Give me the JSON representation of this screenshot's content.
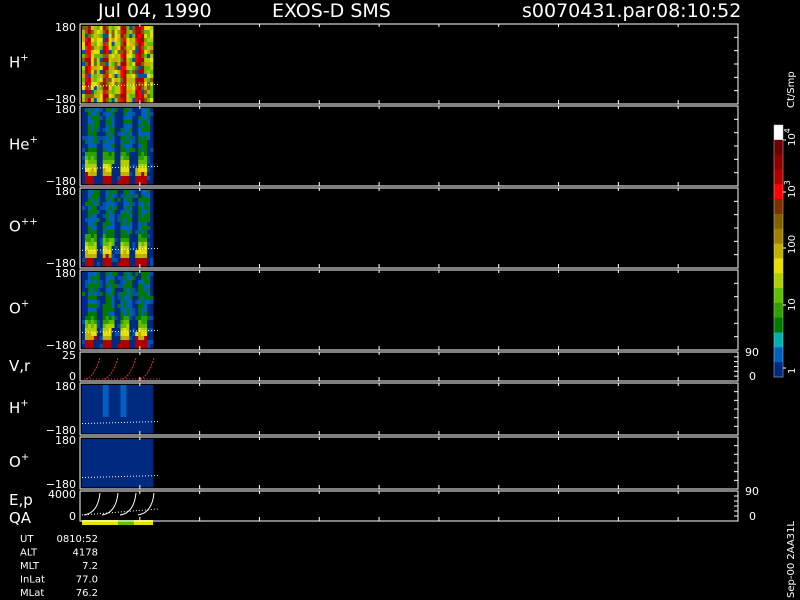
{
  "header": {
    "date": "Jul 04, 1990",
    "instrument": "EXOS-D SMS",
    "filename": "s0070431.par",
    "time": "08:10:52"
  },
  "chart_data": {
    "type": "heatmap",
    "panels": [
      {
        "id": "h",
        "label": "H",
        "sup": "+",
        "y_top": "180",
        "y_bottom": "−180",
        "ylim": [
          -180,
          180
        ]
      },
      {
        "id": "he",
        "label": "He",
        "sup": "+",
        "y_top": "180",
        "y_bottom": "−180",
        "ylim": [
          -180,
          180
        ]
      },
      {
        "id": "opp",
        "label": "O",
        "sup": "++",
        "y_top": "180",
        "y_bottom": "−180",
        "ylim": [
          -180,
          180
        ]
      },
      {
        "id": "o",
        "label": "O",
        "sup": "+",
        "y_top": "180",
        "y_bottom": "−180",
        "ylim": [
          -180,
          180
        ]
      },
      {
        "id": "vr",
        "label": "V,r",
        "sup": "",
        "y_top": "25",
        "y_bottom": "0",
        "right_top": "90",
        "right_bottom": "0",
        "ylim": [
          0,
          25
        ]
      },
      {
        "id": "h2",
        "label": "H",
        "sup": "+",
        "y_top": "180",
        "y_bottom": "−180",
        "ylim": [
          -180,
          180
        ]
      },
      {
        "id": "o2",
        "label": "O",
        "sup": "+",
        "y_top": "180",
        "y_bottom": "−180",
        "ylim": [
          -180,
          180
        ]
      },
      {
        "id": "ep",
        "label": "E,p",
        "label2": "QA",
        "sup": "",
        "y_top": "4000",
        "y_bottom": "0",
        "right_top": "90",
        "right_bottom": "0",
        "ylim": [
          0,
          4000
        ]
      }
    ],
    "colorbar": {
      "unit": "Ct/Smp",
      "ticks": [
        {
          "base": "10",
          "exp": "4"
        },
        {
          "base": "10",
          "exp": "3"
        },
        {
          "base": "100",
          "exp": ""
        },
        {
          "base": "10",
          "exp": ""
        },
        {
          "base": "1",
          "exp": ""
        }
      ],
      "colors": [
        "#ffffff",
        "#6a0000",
        "#8c0000",
        "#b00000",
        "#ff0000",
        "#7a3000",
        "#806000",
        "#a08000",
        "#c0b000",
        "#e8e000",
        "#b0d000",
        "#60c000",
        "#30a000",
        "#007a00",
        "#00b0b0",
        "#0060c0",
        "#002a80"
      ]
    },
    "info_labels": [
      "UT",
      "ALT",
      "MLT",
      "InLat",
      "MLat"
    ],
    "info_values": [
      "0810:52",
      "4178",
      "7.2",
      "77.0",
      "76.2"
    ],
    "footer_right": "Sep-00 2AA31L"
  }
}
